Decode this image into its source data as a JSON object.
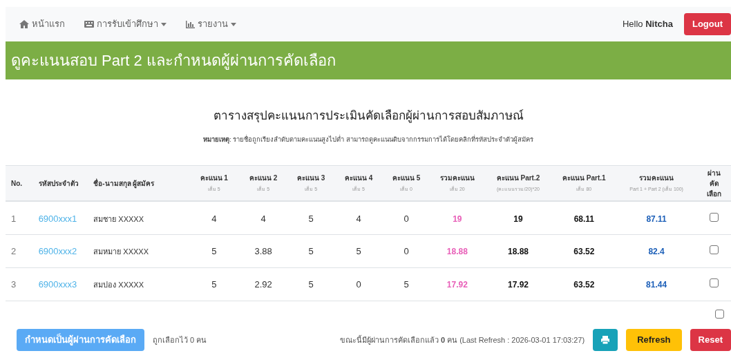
{
  "navbar": {
    "items": [
      {
        "label": "หน้าแรก",
        "dropdown": false
      },
      {
        "label": "การรับเข้าศึกษา",
        "dropdown": true
      },
      {
        "label": "รายงาน",
        "dropdown": true
      }
    ],
    "greeting": "Hello **Nitcha**",
    "logout": "Logout"
  },
  "banner": {
    "title": "ดูคะแนนสอบ Part 2 และกำหนดผู้ผ่านการคัดเลือก"
  },
  "heading": "ตารางสรุปคะแนนการประเมินคัดเลือกผู้ผ่านการสอบสัมภาษณ์",
  "note": "**หมายเหตุ**: รายชื่อถูกเรียงลำดับตามคะแนนสูงไปต่ำ สามารถดูคะแนนดิบจากกรรมการได้โดยคลิกที่รหัสประจำตัวผู้สมัคร",
  "table": {
    "columns": [
      {
        "label": "No.",
        "kind": "no"
      },
      {
        "label": "รหัสประจำตัว",
        "kind": "link"
      },
      {
        "label": "ชื่อ-นามสกุล ผู้สมัคร",
        "kind": "name"
      },
      {
        "label": "คะแนน 1",
        "sub": "เต็ม 5",
        "kind": "plain"
      },
      {
        "label": "คะแนน 2",
        "sub": "เต็ม 5",
        "kind": "plain"
      },
      {
        "label": "คะแนน 3",
        "sub": "เต็ม 5",
        "kind": "plain"
      },
      {
        "label": "คะแนน 4",
        "sub": "เต็ม 5",
        "kind": "plain"
      },
      {
        "label": "คะแนน 5",
        "sub": "เต็ม 0",
        "kind": "plain"
      },
      {
        "label": "รวมคะแนน",
        "sub": "เต็ม 20",
        "kind": "total"
      },
      {
        "label": "คะแนน Part.2",
        "sub": "(คะแนนรวม/20)*20",
        "kind": "bold"
      },
      {
        "label": "คะแนน Part.1",
        "sub": "เต็ม 80",
        "kind": "bold"
      },
      {
        "label": "รวมคะแนน",
        "sub": "Part 1 + Part 2 (เต็ม 100)",
        "kind": "sum"
      },
      {
        "label": "ผ่าน คัดเลือก",
        "kind": "check"
      }
    ],
    "rows": [
      {
        "cells": [
          "1",
          "6900xxx1",
          "สมชาย XXXXX",
          "4",
          "4",
          "5",
          "4",
          "0",
          "19",
          "19",
          "68.11",
          "87.11"
        ],
        "checked": false
      },
      {
        "cells": [
          "2",
          "6900xxx2",
          "สมหมาย XXXXX",
          "5",
          "3.88",
          "5",
          "5",
          "0",
          "18.88",
          "18.88",
          "63.52",
          "82.4"
        ],
        "checked": false
      },
      {
        "cells": [
          "3",
          "6900xxx3",
          "สมปอง XXXXX",
          "5",
          "2.92",
          "5",
          "0",
          "5",
          "17.92",
          "17.92",
          "63.52",
          "81.44"
        ],
        "checked": false
      }
    ],
    "select_all_checked": false
  },
  "footer": {
    "action": "กำหนดเป็นผู้ผ่านการคัดเลือก",
    "selected_count": "ถูกเลือกไว้ 0 คน",
    "status": "ขณะนี้มีผู้ผ่านการคัดเลือกแล้ว **0** คน (Last Refresh : 2026-03-01 17:03:27)",
    "refresh": "Refresh",
    "reset": "Reset"
  }
}
